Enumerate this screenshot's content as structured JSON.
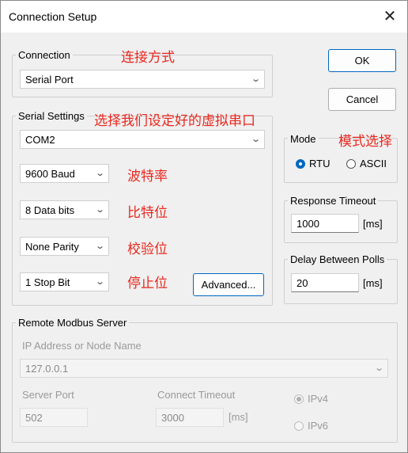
{
  "window": {
    "title": "Connection Setup",
    "close_glyph": "✕"
  },
  "connection": {
    "legend": "Connection",
    "note": "连接方式",
    "value": "Serial Port"
  },
  "buttons": {
    "ok": "OK",
    "cancel": "Cancel",
    "advanced": "Advanced..."
  },
  "serial": {
    "legend": "Serial Settings",
    "note": "选择我们设定好的虚拟串口",
    "port": "COM2",
    "baud": "9600 Baud",
    "baud_note": "波特率",
    "data_bits": "8 Data bits",
    "data_bits_note": "比特位",
    "parity": "None Parity",
    "parity_note": "校验位",
    "stop_bits": "1 Stop Bit",
    "stop_bits_note": "停止位"
  },
  "mode": {
    "legend": "Mode",
    "note": "模式选择",
    "rtu": "RTU",
    "ascii": "ASCII",
    "selected": "RTU"
  },
  "response_timeout": {
    "legend": "Response Timeout",
    "value": "1000",
    "unit": "[ms]"
  },
  "delay_polls": {
    "legend": "Delay Between Polls",
    "value": "20",
    "unit": "[ms]"
  },
  "remote": {
    "legend": "Remote Modbus Server",
    "ip_label": "IP Address or Node Name",
    "ip_value": "127.0.0.1",
    "port_label": "Server Port",
    "port_value": "502",
    "timeout_label": "Connect Timeout",
    "timeout_value": "3000",
    "timeout_unit": "[ms]",
    "ipv4": "IPv4",
    "ipv6": "IPv6"
  },
  "colors": {
    "annotation": "#e8281f",
    "accent": "#0067c0"
  }
}
